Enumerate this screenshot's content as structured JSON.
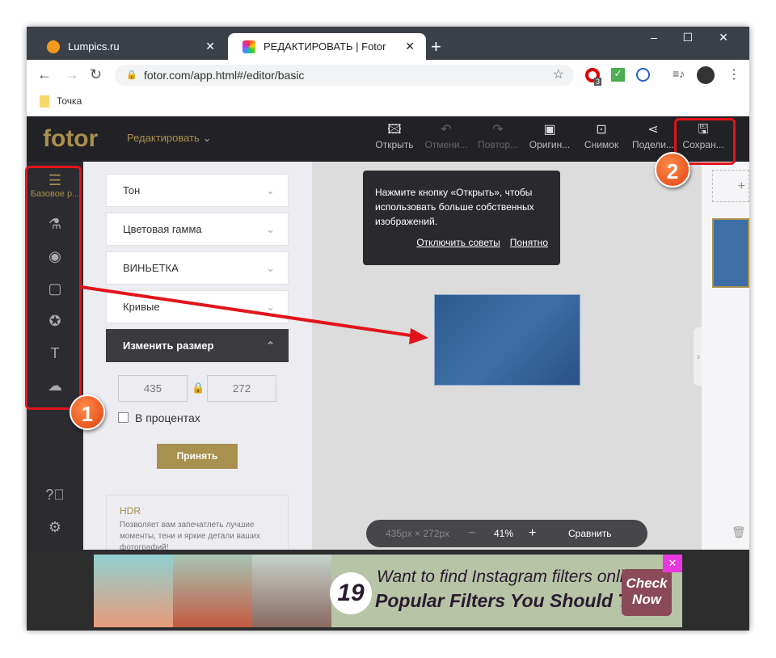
{
  "browser": {
    "tabs": [
      {
        "label": "Lumpics.ru",
        "active": false
      },
      {
        "label": "РЕДАКТИРОВАТЬ | Fotor",
        "active": true
      }
    ],
    "url": "fotor.com/app.html#/editor/basic",
    "extension_badge": "3",
    "bookmark": "Точка"
  },
  "app": {
    "logo": "fotor",
    "menu": "Редактировать",
    "toolbar": [
      {
        "label": "Открыть",
        "icon": "image-add-icon",
        "enabled": true
      },
      {
        "label": "Отмени...",
        "icon": "undo-icon",
        "enabled": false
      },
      {
        "label": "Повтор...",
        "icon": "redo-icon",
        "enabled": false
      },
      {
        "label": "Оригин...",
        "icon": "original-icon",
        "enabled": true
      },
      {
        "label": "Снимок",
        "icon": "snapshot-icon",
        "enabled": true
      },
      {
        "label": "Подели...",
        "icon": "share-icon",
        "enabled": true
      },
      {
        "label": "Сохран...",
        "icon": "save-icon",
        "enabled": true
      }
    ],
    "sidebar": {
      "active_label": "Базовое р..."
    },
    "panel": {
      "sections": [
        "Тон",
        "Цветовая гамма",
        "ВИНЬЕТКА",
        "Кривые"
      ],
      "active_section": "Изменить размер",
      "width": "435",
      "height": "272",
      "percent_label": "В процентах",
      "apply": "Принять",
      "hdr_title": "HDR",
      "hdr_text": "Позволяет вам запечатлеть лучшие моменты, тени и яркие детали ваших фотографий!"
    },
    "tooltip": {
      "text": "Нажмите кнопку «Открыть», чтобы использовать больше собственных изображений.",
      "disable": "Отключить советы",
      "ok": "Понятно"
    },
    "zoombar": {
      "size": "435px × 272px",
      "zoom": "41%",
      "compare": "Сравнить"
    }
  },
  "ad": {
    "number": "19",
    "line1": "Want to find Instagram filters online?",
    "line2": "Popular Filters You Should Try",
    "cta1": "Check",
    "cta2": "Now"
  },
  "annotations": [
    "1",
    "2"
  ],
  "colors": {
    "accent": "#a8904e",
    "annotation": "#e1141b"
  }
}
